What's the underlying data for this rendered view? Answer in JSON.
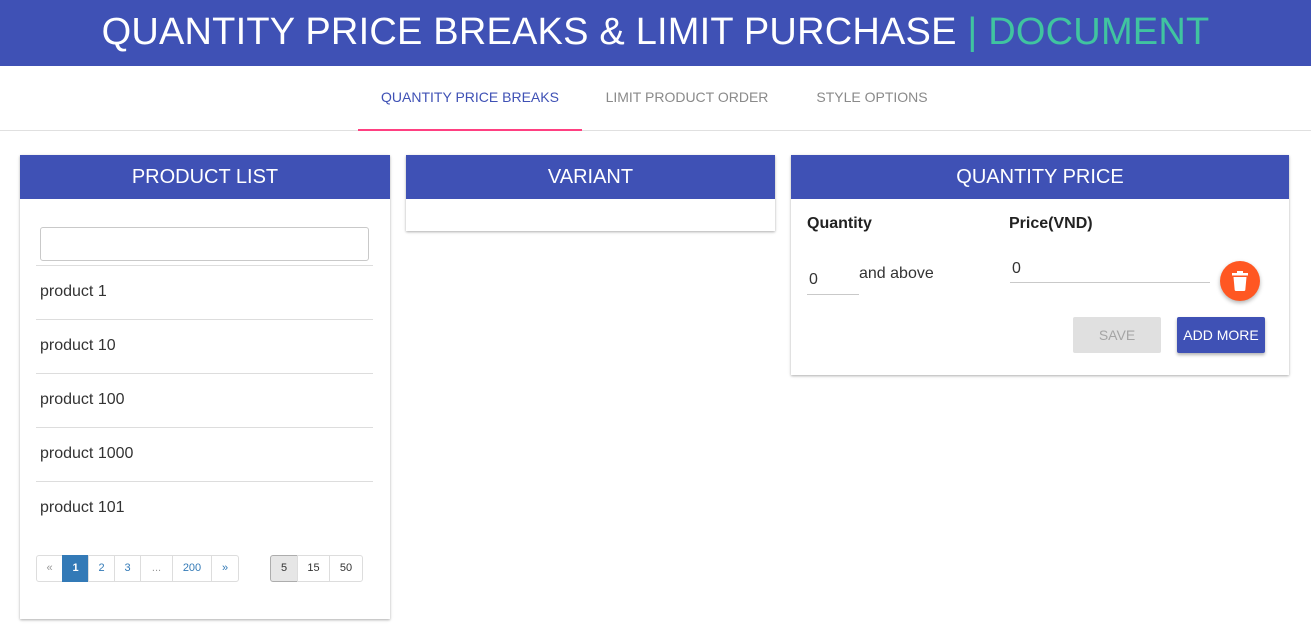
{
  "header": {
    "title": "QUANTITY PRICE BREAKS & LIMIT PURCHASE",
    "separator": "|",
    "accent": "DOCUMENT"
  },
  "tabs": [
    {
      "label": "QUANTITY PRICE BREAKS",
      "active": true
    },
    {
      "label": "LIMIT PRODUCT ORDER",
      "active": false
    },
    {
      "label": "STYLE OPTIONS",
      "active": false
    }
  ],
  "product_list": {
    "title": "PRODUCT LIST",
    "search_value": "",
    "items": [
      "product 1",
      "product 10",
      "product 100",
      "product 1000",
      "product 101"
    ],
    "pagination": [
      "«",
      "1",
      "2",
      "3",
      "...",
      "200",
      "»"
    ],
    "current_page": "1",
    "page_sizes": [
      "5",
      "15",
      "50"
    ],
    "selected_page_size": "5"
  },
  "variant": {
    "title": "VARIANT"
  },
  "quantity_price": {
    "title": "QUANTITY PRICE",
    "quantity_label": "Quantity",
    "price_label": "Price(VND)",
    "quantity_value": "0",
    "and_above": "and above",
    "price_value": "0",
    "save_label": "SAVE",
    "add_more_label": "ADD MORE",
    "delete_icon": "trash-icon"
  },
  "colors": {
    "primary": "#3f51b5",
    "accent_text": "#40c4a0",
    "tab_indicator": "#ff4081",
    "delete_button": "#ff5722",
    "pager_active": "#337ab7"
  }
}
